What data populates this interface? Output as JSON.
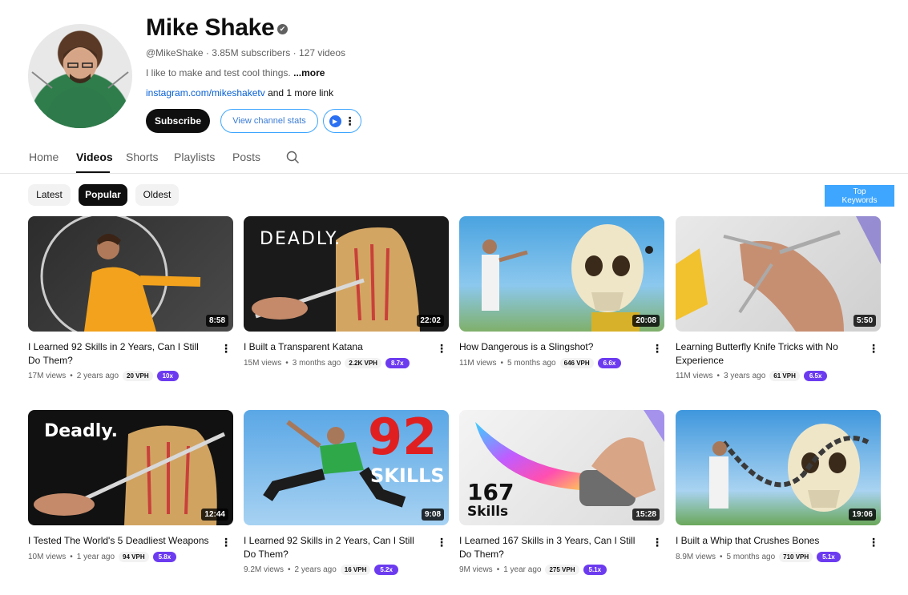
{
  "channel": {
    "name": "Mike Shake",
    "handle": "@MikeShake",
    "subscribers": "3.85M subscribers",
    "videos_count": "127 videos",
    "separator": "·",
    "description": "I like to make and test cool things.",
    "more": "...more",
    "link": "instagram.com/mikeshaketv",
    "link_suffix": "and 1 more link"
  },
  "buttons": {
    "subscribe": "Subscribe",
    "view_stats": "View channel stats",
    "extension_icon": "ext-logo-icon"
  },
  "tabs": [
    "Home",
    "Videos",
    "Shorts",
    "Playlists",
    "Posts"
  ],
  "active_tab": "Videos",
  "chips": {
    "latest": "Latest",
    "popular": "Popular",
    "oldest": "Oldest",
    "selected": "Popular"
  },
  "top_keywords": {
    "line1": "Top",
    "line2": "Keywords"
  },
  "videos": [
    {
      "title": "I Learned 92 Skills in 2 Years, Can I Still Do Them?",
      "duration": "8:58",
      "views": "17M views",
      "age": "2 years ago",
      "vph": "20 VPH",
      "multiplier": "10x"
    },
    {
      "title": "I Built a Transparent Katana",
      "duration": "22:02",
      "views": "15M views",
      "age": "3 months ago",
      "vph": "2.2K VPH",
      "multiplier": "8.7x",
      "thumb_text": "DEADLY."
    },
    {
      "title": "How Dangerous is a Slingshot?",
      "duration": "20:08",
      "views": "11M views",
      "age": "5 months ago",
      "vph": "646 VPH",
      "multiplier": "6.6x"
    },
    {
      "title": "Learning Butterfly Knife Tricks with No Experience",
      "duration": "5:50",
      "views": "11M views",
      "age": "3 years ago",
      "vph": "61 VPH",
      "multiplier": "6.5x"
    },
    {
      "title": "I Tested The World's 5 Deadliest Weapons",
      "duration": "12:44",
      "views": "10M views",
      "age": "1 year ago",
      "vph": "94 VPH",
      "multiplier": "5.8x",
      "thumb_text": "Deadly."
    },
    {
      "title": "I Learned 92 Skills in 2 Years, Can I Still Do Them?",
      "duration": "9:08",
      "views": "9.2M views",
      "age": "2 years ago",
      "vph": "16 VPH",
      "multiplier": "5.2x",
      "thumb_text": "92",
      "thumb_text2": "SKILLS"
    },
    {
      "title": "I Learned 167 Skills in 3 Years, Can I Still Do Them?",
      "duration": "15:28",
      "views": "9M views",
      "age": "1 year ago",
      "vph": "275 VPH",
      "multiplier": "5.1x",
      "thumb_text": "167",
      "thumb_text2": "Skills"
    },
    {
      "title": "I Built a Whip that Crushes Bones",
      "duration": "19:06",
      "views": "8.9M views",
      "age": "5 months ago",
      "vph": "710 VPH",
      "multiplier": "5.1x"
    }
  ],
  "colors": {
    "accent_blue": "#3ea6ff",
    "multiplier_purple": "#6c3bf0",
    "link_blue": "#065fd4"
  }
}
